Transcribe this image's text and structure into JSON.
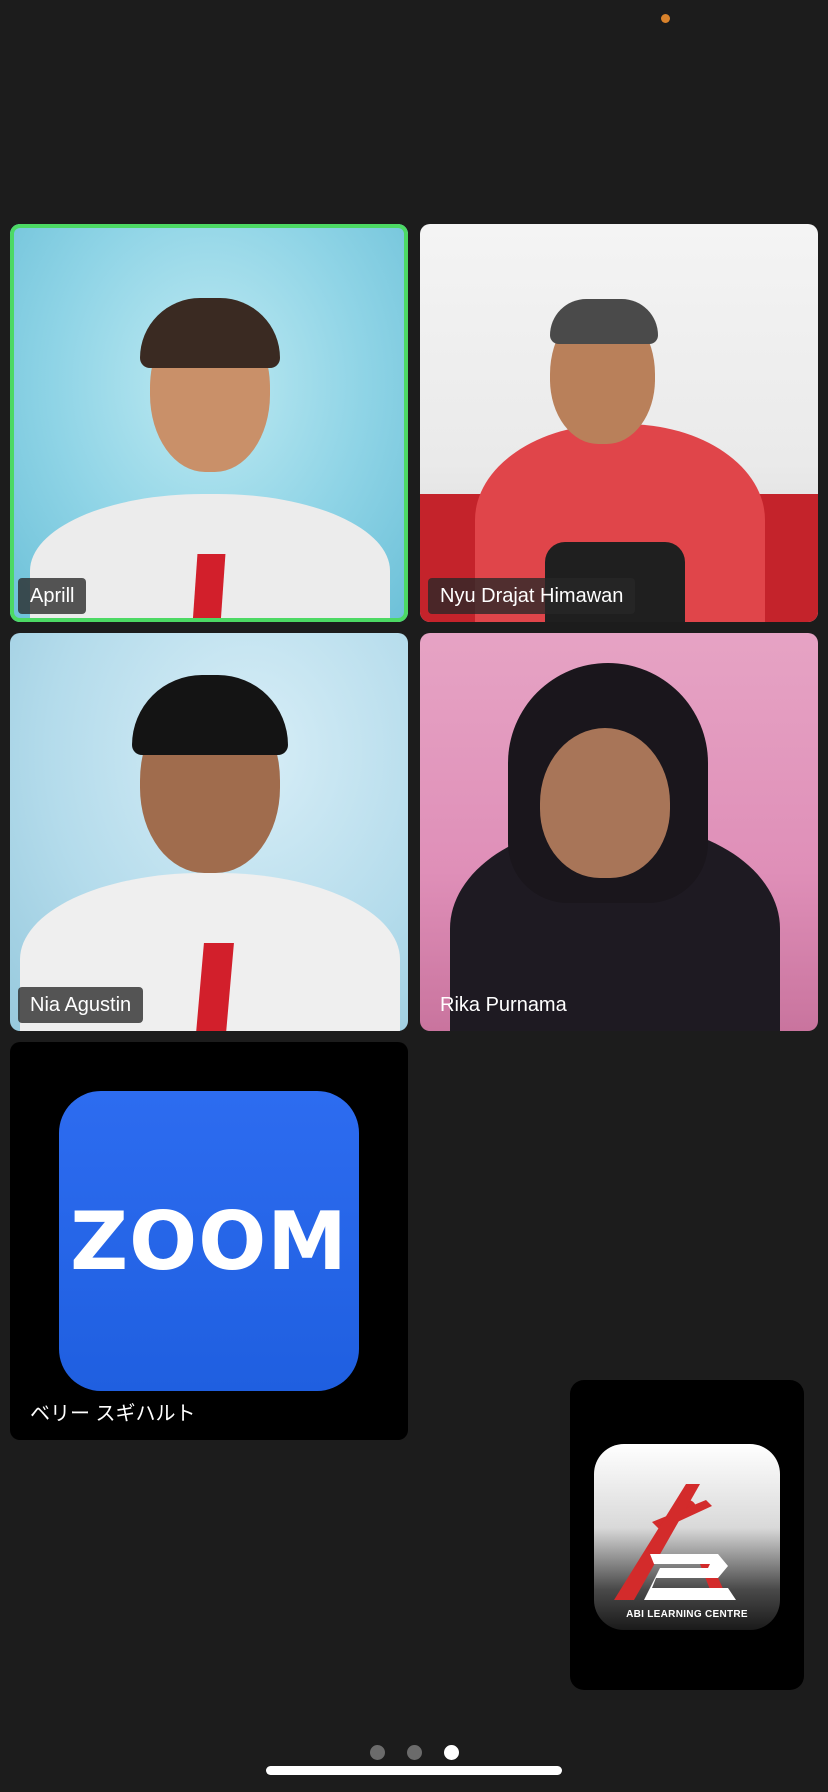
{
  "participants": [
    {
      "name": "Aprill",
      "active_speaker": true
    },
    {
      "name": "Nyu Drajat Himawan",
      "active_speaker": false
    },
    {
      "name": "Nia Agustin",
      "active_speaker": false
    },
    {
      "name": "Rika Purnama",
      "active_speaker": false
    },
    {
      "name": "ベリー スギハルト",
      "active_speaker": false,
      "avatar": "ZOOM"
    }
  ],
  "self_view": {
    "avatar_text": "ABI LEARNING CENTRE"
  },
  "pagination": {
    "total_pages": 3,
    "current_page": 3
  },
  "colors": {
    "background": "#1c1c1c",
    "active_speaker_border": "#4cd964",
    "zoom_blue": "#2d6cf0",
    "recording_dot": "#d9822b"
  },
  "icons": {
    "status_indicator": "recording-dot-icon",
    "zoom_logo": "zoom-logo-icon",
    "abi_logo": "abi-logo-icon"
  }
}
